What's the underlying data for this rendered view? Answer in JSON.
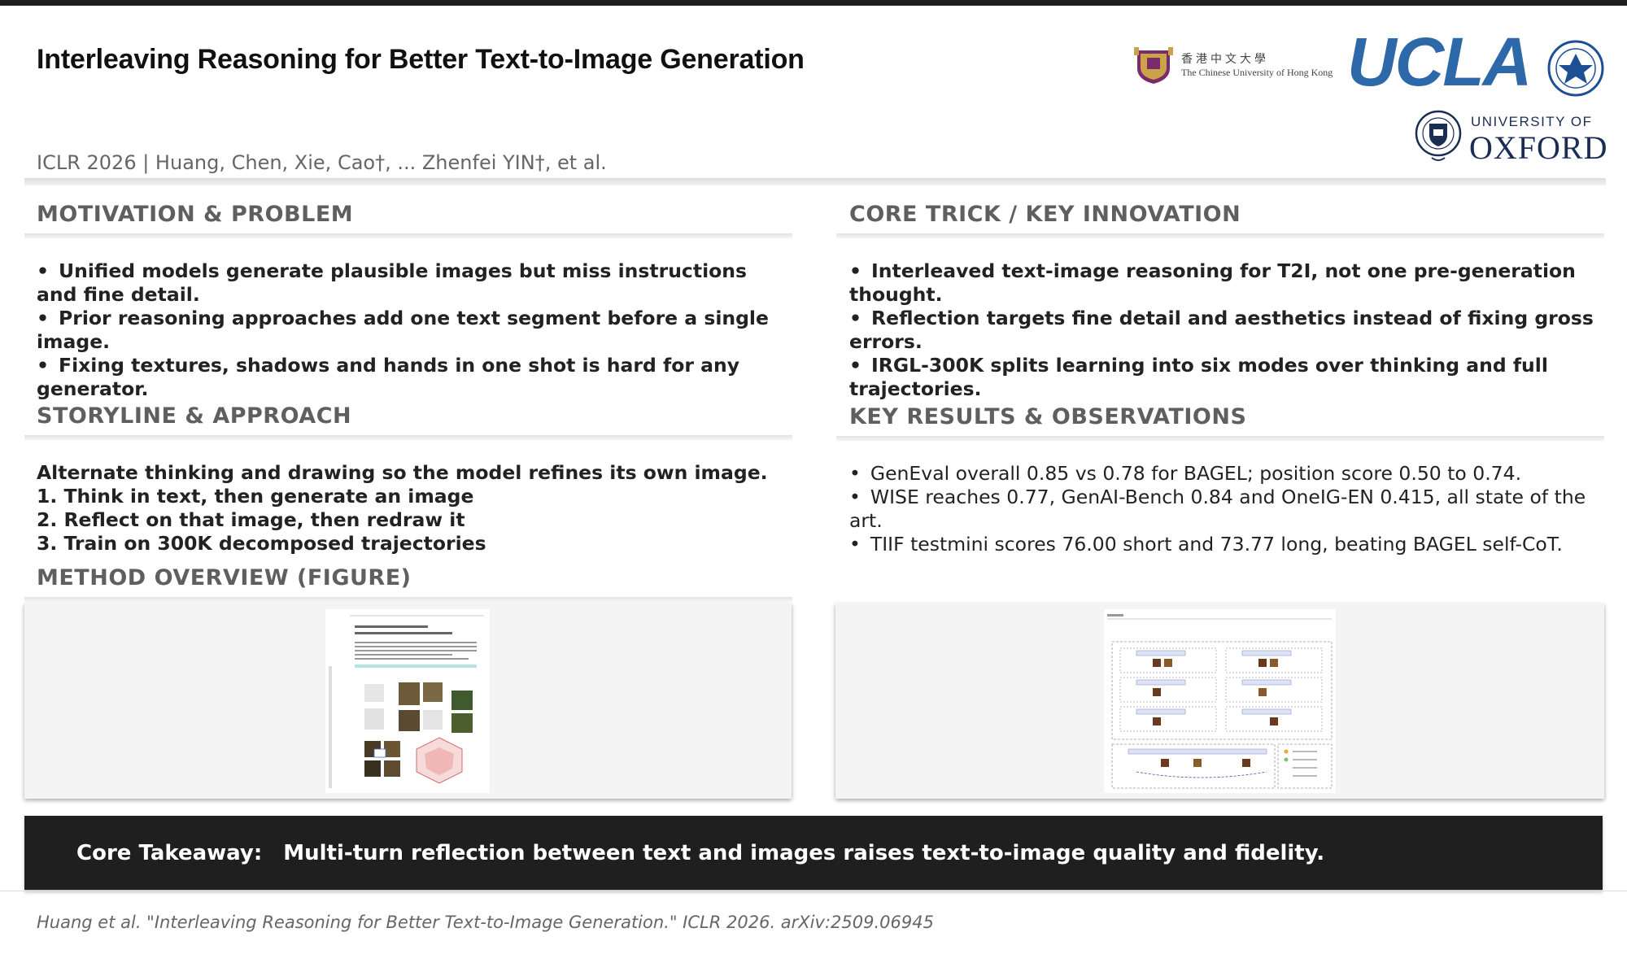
{
  "header": {
    "title": "Interleaving Reasoning for Better Text-to-Image Generation",
    "authors": "ICLR 2026 | Huang, Chen, Xie, Cao†, ... Zhenfei YIN†, et al."
  },
  "logos": {
    "cuhk_cn": "香港中文大學",
    "cuhk_en": "The Chinese University of Hong Kong",
    "ucla": "UCLA",
    "oxford_top": "UNIVERSITY OF",
    "oxford_name": "OXFORD"
  },
  "motivation": {
    "heading": "MOTIVATION & PROBLEM",
    "bullets": [
      "Unified models generate plausible images but miss instructions and fine detail.",
      "Prior reasoning approaches add one text segment before a single image.",
      "Fixing textures, shadows and hands in one shot is hard for any generator."
    ]
  },
  "storyline": {
    "heading": "STORYLINE & APPROACH",
    "lines": [
      "Alternate thinking and drawing so the model refines its own image.",
      "1. Think in text, then generate an image",
      "2. Reflect on that image, then redraw it",
      "3. Train on 300K decomposed trajectories"
    ]
  },
  "method": {
    "heading": "METHOD OVERVIEW (FIGURE)"
  },
  "core_trick": {
    "heading": "CORE TRICK / KEY INNOVATION",
    "bullets": [
      "Interleaved text-image reasoning for T2I, not one pre-generation thought.",
      "Reflection targets fine detail and aesthetics instead of fixing gross errors.",
      "IRGL-300K splits learning into six modes over thinking and full trajectories."
    ]
  },
  "results": {
    "heading": "KEY RESULTS & OBSERVATIONS",
    "bullets": [
      "GenEval overall 0.85 vs 0.78 for BAGEL; position score 0.50 to 0.74.",
      "WISE reaches 0.77, GenAI-Bench 0.84 and OneIG-EN 0.415, all state of the art.",
      "TIIF testmini scores 76.00 short and 73.77 long, beating BAGEL self-CoT."
    ]
  },
  "takeaway": {
    "label": "Core Takeaway:",
    "text": "Multi-turn reflection between text and images raises text-to-image quality and fidelity."
  },
  "citation": "Huang et al. \"Interleaving Reasoning for Better Text-to-Image Generation.\" ICLR 2026. arXiv:2509.06945",
  "colors": {
    "heading_gray": "#5f5f5f",
    "ucla_blue": "#2d68a8",
    "oxford_navy": "#1b2d55",
    "takeaway_bg": "#1f1f1f"
  }
}
